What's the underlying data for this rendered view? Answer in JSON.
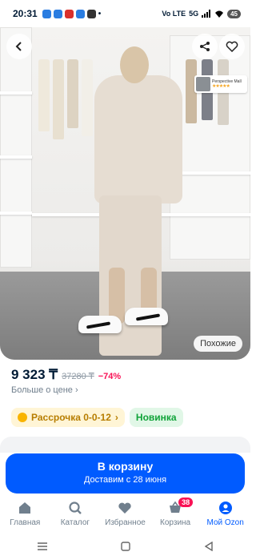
{
  "status": {
    "time": "20:31",
    "network": "Vo LTE",
    "signal": "5G",
    "battery": "45"
  },
  "photo": {
    "similar_label": "Похожие",
    "brand": {
      "name": "Perspective Mall",
      "stars": "★★★★★"
    }
  },
  "product": {
    "price": "9 323 ₸",
    "old_price": "37280 ₸",
    "discount": "−74%",
    "more_price_label": "Больше о цене",
    "chevron": "›",
    "installment_label": "Рассрочка 0-0-12",
    "installment_chevron": "›",
    "new_badge": "Новинка"
  },
  "cart": {
    "title": "В корзину",
    "subtitle": "Доставим с 28 июня"
  },
  "bottom_nav": [
    {
      "label": "Главная",
      "icon": "home-icon"
    },
    {
      "label": "Каталог",
      "icon": "search-icon"
    },
    {
      "label": "Избранное",
      "icon": "heart-icon"
    },
    {
      "label": "Корзина",
      "icon": "cart-icon",
      "badge": "38"
    },
    {
      "label": "Мой Ozon",
      "icon": "profile-icon",
      "active": true
    }
  ],
  "colors": {
    "accent": "#005bff",
    "discount": "#f91155",
    "new": "#10a339",
    "installment": "#b77d00"
  }
}
